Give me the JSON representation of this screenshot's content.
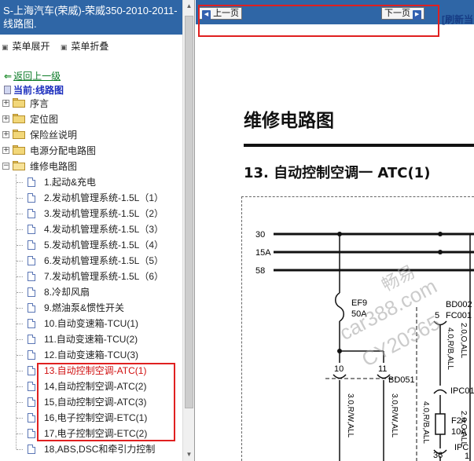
{
  "left_panel": {
    "title": "S-上海汽车(荣威)-荣威350-2010-2011- 线路图.",
    "menu": {
      "expand": "菜单展开",
      "collapse": "菜单折叠"
    },
    "back": "返回上一级",
    "current": "当前:线路图",
    "folders": [
      {
        "label": "序言",
        "expanded": false
      },
      {
        "label": "定位图",
        "expanded": false
      },
      {
        "label": "保险丝说明",
        "expanded": false
      },
      {
        "label": "电源分配电路图",
        "expanded": false
      },
      {
        "label": "维修电路图",
        "expanded": true
      }
    ],
    "items": [
      "1.起动&充电",
      "2.发动机管理系统-1.5L（1）",
      "3.发动机管理系统-1.5L（2）",
      "4.发动机管理系统-1.5L（3）",
      "5.发动机管理系统-1.5L（4）",
      "6.发动机管理系统-1.5L（5）",
      "7.发动机管理系统-1.5L（6）",
      "8.冷却风扇",
      "9.燃油泵&惯性开关",
      "10.自动变速箱-TCU(1)",
      "11.自动变速箱-TCU(2)",
      "12.自动变速箱-TCU(3)",
      "13.自动控制空调-ATC(1)",
      "14,自动控制空调-ATC(2)",
      "15,自动控制空调-ATC(3)",
      "16,电子控制空调-ETC(1)",
      "17,电子控制空调-ETC(2)",
      "18,ABS,DSC和牵引力控制"
    ],
    "selected_index": 12
  },
  "page_nav": {
    "prev": "上一页",
    "next": "下一页",
    "refresh": "[刷新当"
  },
  "document": {
    "title": "维修电路图",
    "section": "13.  自动控制空调一 ATC(1)"
  },
  "diagram": {
    "rails": [
      "30",
      "15A",
      "58"
    ],
    "fuse_ef9": {
      "name": "EF9",
      "rating": "50A"
    },
    "connector_bd002": "BD002",
    "connector_fc001": "FC001",
    "pin_5": "5",
    "wire_a": "4.0,R/B,ALL",
    "wire_b": "2.0,O,ALL",
    "pin_10": "10",
    "pin_11": "11",
    "connector_bd051": "BD051",
    "wire_c": "3.0,R/W,ALL",
    "wire_d": "3.0,R/W,ALL",
    "wire_e": "4.0,R/B,ALL",
    "ipc01": "IPC01",
    "fuse_f24": {
      "name": "F24",
      "rating": "10A"
    },
    "pin_36": "36",
    "ipc": "IPC",
    "pin_1": "1",
    "wire_f": "2.0,O,ALL",
    "watermark": [
      "畅易",
      "car388.com",
      "CY20365"
    ]
  }
}
